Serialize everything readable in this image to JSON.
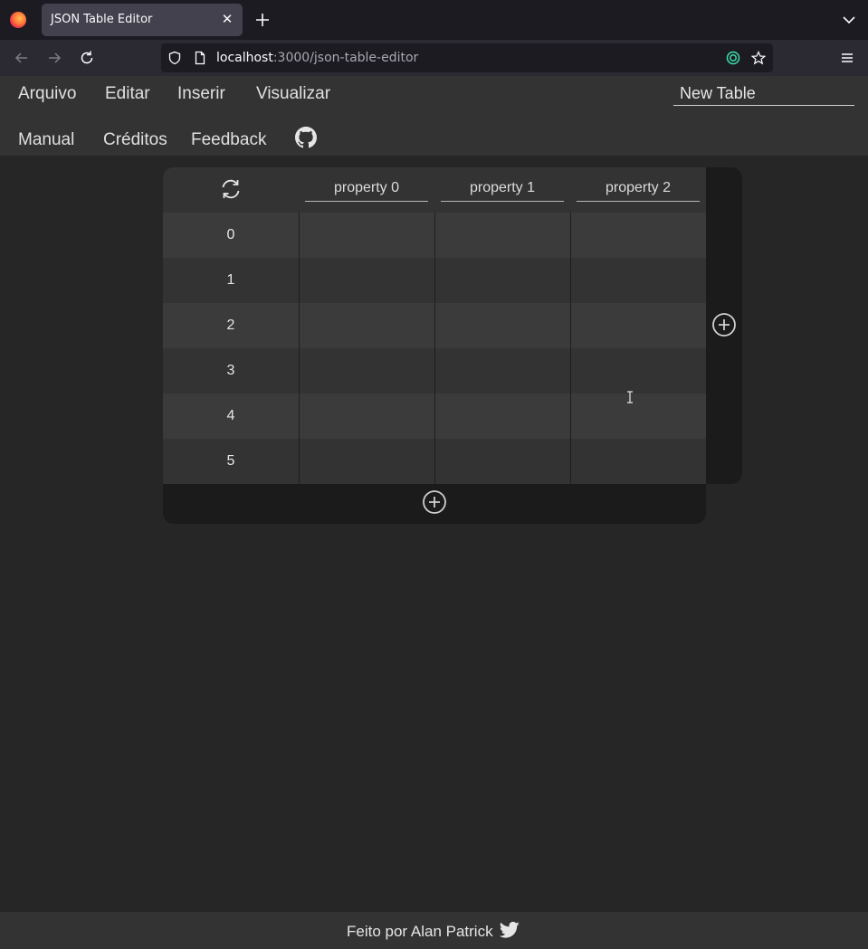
{
  "browser": {
    "tab_title": "JSON Table Editor",
    "tab_close": "✕",
    "url_host": "localhost",
    "url_path": ":3000/json-table-editor"
  },
  "menu": {
    "items": [
      "Arquivo",
      "Editar",
      "Inserir",
      "Visualizar"
    ],
    "secondary": [
      "Manual",
      "Créditos",
      "Feedback"
    ]
  },
  "table_name": "New Table",
  "table": {
    "columns": [
      "property 0",
      "property 1",
      "property 2"
    ],
    "rows": [
      "0",
      "1",
      "2",
      "3",
      "4",
      "5"
    ]
  },
  "footer": {
    "text": "Feito por Alan Patrick"
  },
  "colors": {
    "background": "#262626",
    "header": "#333333",
    "panel": "#1b1b1b",
    "row_alt": "#3b3b3b"
  }
}
